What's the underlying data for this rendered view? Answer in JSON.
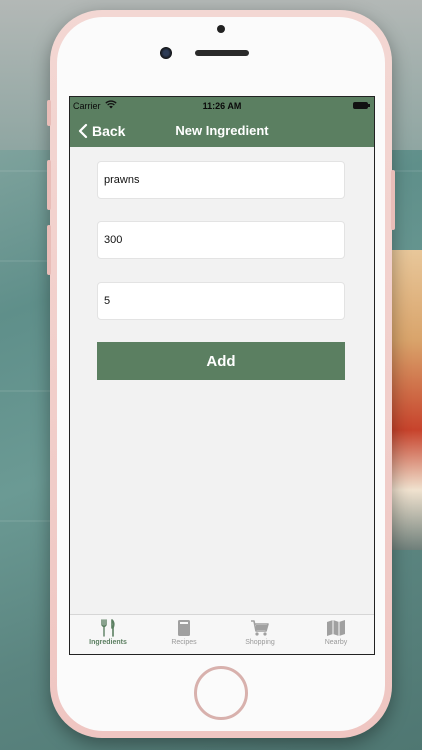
{
  "status_bar": {
    "carrier": "Carrier",
    "time": "11:26 AM"
  },
  "nav": {
    "back_label": "Back",
    "title": "New Ingredient"
  },
  "form": {
    "name_value": "prawns",
    "amount_value": "300",
    "quantity_value": "5",
    "add_label": "Add"
  },
  "tabs": [
    {
      "label": "Ingredients",
      "icon": "fork-knife-icon",
      "active": true
    },
    {
      "label": "Recipes",
      "icon": "book-icon",
      "active": false
    },
    {
      "label": "Shopping",
      "icon": "cart-icon",
      "active": false
    },
    {
      "label": "Nearby",
      "icon": "map-icon",
      "active": false
    }
  ],
  "colors": {
    "accent": "#5b7f61",
    "screen_background": "#f2f2f2",
    "phone_frame": "#efc6c2"
  }
}
